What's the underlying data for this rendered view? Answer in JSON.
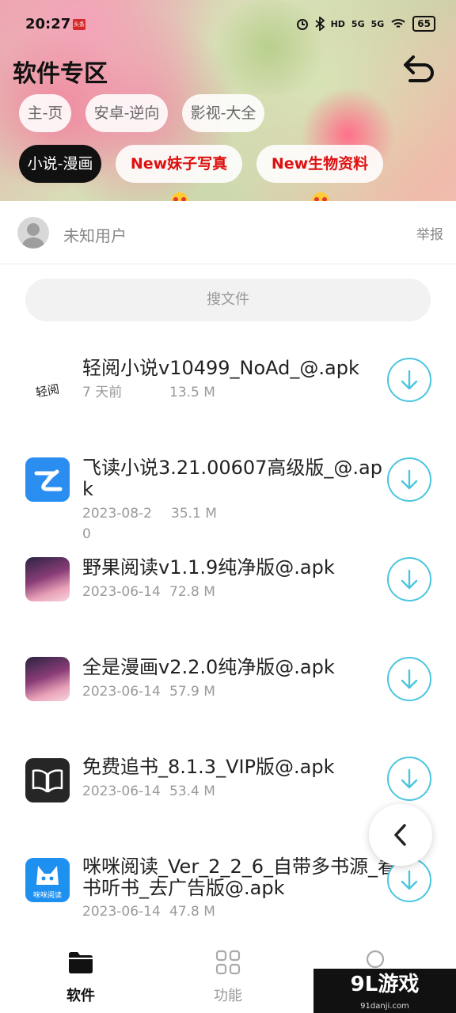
{
  "status_bar": {
    "time": "20:27",
    "badge": "头条",
    "network": [
      "HD",
      "5G",
      "5G"
    ],
    "battery": "65"
  },
  "header": {
    "title": "软件专区",
    "back_icon": "undo-arrow-icon",
    "chips": [
      {
        "label": "主-页",
        "active": false
      },
      {
        "label": "安卓-逆向",
        "active": false
      },
      {
        "label": "影视-大全",
        "active": false
      },
      {
        "label": "小说-漫画",
        "active": true
      },
      {
        "label": "New妹子写真",
        "active": false,
        "emoji": "heart-eyes-icon"
      },
      {
        "label": "New生物资料",
        "active": false,
        "emoji": "heart-eyes-icon"
      }
    ]
  },
  "user": {
    "name": "未知用户",
    "report": "举报"
  },
  "search": {
    "placeholder": "搜文件"
  },
  "files": [
    {
      "name": "轻阅小说v10499_NoAd_@.apk",
      "date": "7 天前",
      "size": "13.5 M",
      "icon": "qingyue-app-icon",
      "icon_text": "轻阅"
    },
    {
      "name": "飞读小说3.21.00607高级版_@.apk",
      "date": "2023-08-20",
      "size": "35.1 M",
      "icon": "feidu-app-icon"
    },
    {
      "name": "野果阅读v1.1.9纯净版@.apk",
      "date": "2023-06-14",
      "size": "72.8 M",
      "icon": "yeguo-app-icon"
    },
    {
      "name": "全是漫画v2.2.0纯净版@.apk",
      "date": "2023-06-14",
      "size": "57.9 M",
      "icon": "manhua-app-icon"
    },
    {
      "name": "免费追书_8.1.3_VIP版@.apk",
      "date": "2023-06-14",
      "size": "53.4 M",
      "icon": "zhuishu-app-icon"
    },
    {
      "name": "咪咪阅读_Ver_2_2_6_自带多书源_看书听书_去广告版@.apk",
      "date": "2023-06-14",
      "size": "47.8 M",
      "icon": "mimi-app-icon",
      "icon_text": "咪咪阅读"
    }
  ],
  "bottom_nav": [
    {
      "label": "软件",
      "icon": "folder-icon",
      "active": true
    },
    {
      "label": "功能",
      "icon": "grid-icon",
      "active": false
    },
    {
      "label": "",
      "icon": "circle-icon",
      "active": false
    }
  ],
  "watermark": {
    "logo": "9L游戏",
    "domain": "91danji.com"
  },
  "colors": {
    "accent": "#49c6de",
    "active_chip": "#111111",
    "red_chip_text": "#dd1111"
  }
}
